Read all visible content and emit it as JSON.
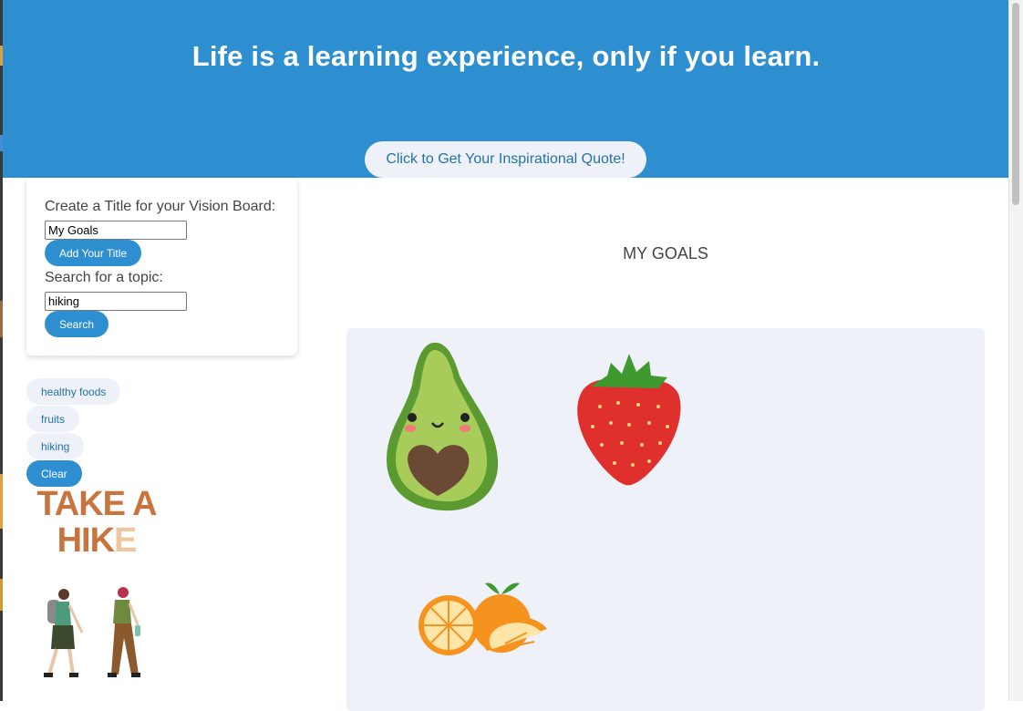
{
  "header": {
    "title": "Life is a learning experience, only if you learn.",
    "quote_button": "Click to Get Your Inspirational Quote!"
  },
  "form": {
    "title_label": "Create a Title for your Vision Board:",
    "title_value": "My Goals",
    "add_title_button": "Add Your Title",
    "search_label": "Search for a topic:",
    "search_value": "hiking",
    "search_button": "Search"
  },
  "topics": [
    "healthy foods",
    "fruits",
    "hiking"
  ],
  "clear_button": "Clear",
  "hike_sticker": {
    "line1": "TAKE A",
    "line2_main": "HIK",
    "line2_light": "E"
  },
  "board": {
    "title": "MY GOALS",
    "images": [
      "avocado-sticker",
      "strawberry-sticker",
      "oranges-sticker"
    ]
  },
  "colors": {
    "brand_blue": "#2e8fd0",
    "chip_bg": "#eef2f8",
    "board_bg": "#eff1f9"
  }
}
